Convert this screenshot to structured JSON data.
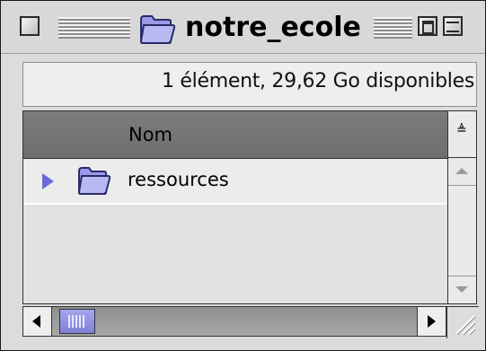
{
  "window": {
    "title": "notre_ecole",
    "folder_icon": "folder-icon"
  },
  "infobar": {
    "text": "1 élément, 29,62 Go disponibles"
  },
  "list": {
    "column_header": "Nom",
    "rows": [
      {
        "label": "ressources",
        "icon": "folder-icon",
        "expanded": false
      }
    ]
  },
  "colors": {
    "folder": "#8f8fe6",
    "disclosure": "#6a6ad8",
    "scroll_thumb": "#8f8fe0",
    "header_bg": "#777777"
  }
}
